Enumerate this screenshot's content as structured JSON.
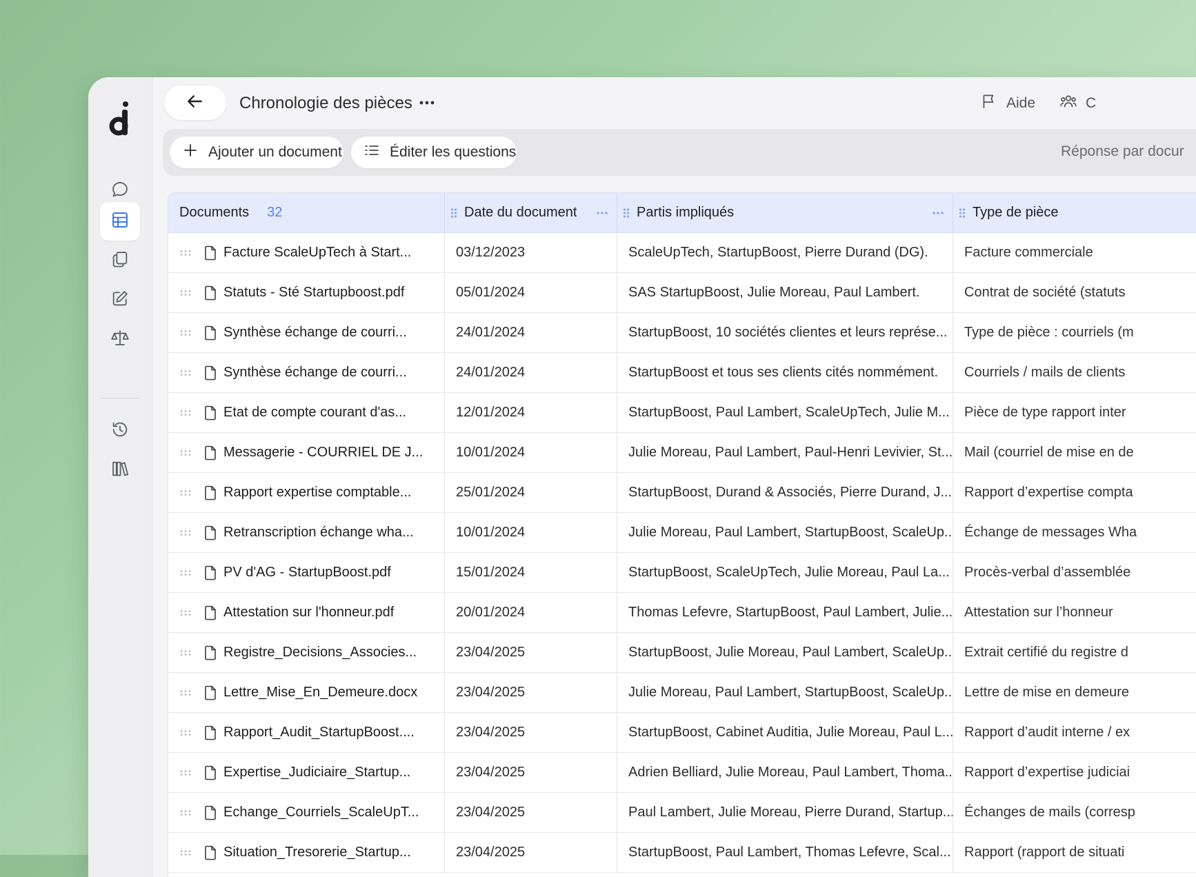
{
  "header": {
    "title": "Chronologie des pièces",
    "help_label": "Aide",
    "partial_label": "C"
  },
  "toolbar": {
    "add_document_label": "Ajouter un document",
    "edit_questions_label": "Éditer les questions",
    "response_label": "Réponse par docur"
  },
  "table": {
    "documents_header": "Documents",
    "documents_count": "32",
    "date_header": "Date du document",
    "parties_header": "Partis impliqués",
    "type_header": "Type de pièce",
    "rows": [
      {
        "name": "Facture ScaleUpTech à Start...",
        "date": "03/12/2023",
        "parties": "ScaleUpTech, StartupBoost, Pierre Durand (DG).",
        "type": "Facture commerciale"
      },
      {
        "name": "Statuts - Sté Startupboost.pdf",
        "date": "05/01/2024",
        "parties": "SAS StartupBoost, Julie Moreau, Paul Lambert.",
        "type": "Contrat de société (statuts"
      },
      {
        "name": "Synthèse échange de courri...",
        "date": "24/01/2024",
        "parties": "StartupBoost, 10 sociétés clientes et leurs représe...",
        "type": "Type de pièce : courriels (m"
      },
      {
        "name": "Synthèse échange de courri...",
        "date": "24/01/2024",
        "parties": "StartupBoost et tous ses clients cités nommément.",
        "type": "Courriels / mails de clients"
      },
      {
        "name": "Etat de compte courant d'as...",
        "date": "12/01/2024",
        "parties": "StartupBoost, Paul Lambert, ScaleUpTech, Julie M...",
        "type": "Pièce de type rapport inter"
      },
      {
        "name": "Messagerie - COURRIEL DE J...",
        "date": "10/01/2024",
        "parties": "Julie Moreau, Paul Lambert, Paul-Henri Levivier, St...",
        "type": "Mail (courriel de mise en de"
      },
      {
        "name": "Rapport expertise comptable...",
        "date": "25/01/2024",
        "parties": "StartupBoost, Durand & Associés, Pierre Durand, J...",
        "type": "Rapport d’expertise compta"
      },
      {
        "name": "Retranscription échange wha...",
        "date": "10/01/2024",
        "parties": "Julie Moreau, Paul Lambert, StartupBoost, ScaleUp...",
        "type": "Échange de messages Wha"
      },
      {
        "name": "PV d'AG - StartupBoost.pdf",
        "date": "15/01/2024",
        "parties": "StartupBoost, ScaleUpTech, Julie Moreau, Paul La...",
        "type": "Procès-verbal d’assemblée"
      },
      {
        "name": "Attestation sur l'honneur.pdf",
        "date": "20/01/2024",
        "parties": "Thomas Lefevre, StartupBoost, Paul Lambert, Julie...",
        "type": "Attestation sur l’honneur"
      },
      {
        "name": "Registre_Decisions_Associes...",
        "date": "23/04/2025",
        "parties": "StartupBoost, Julie Moreau, Paul Lambert, ScaleUp...",
        "type": "Extrait certifié du registre d"
      },
      {
        "name": "Lettre_Mise_En_Demeure.docx",
        "date": "23/04/2025",
        "parties": "Julie Moreau, Paul Lambert, StartupBoost, ScaleUp...",
        "type": "Lettre de mise en demeure"
      },
      {
        "name": "Rapport_Audit_StartupBoost....",
        "date": "23/04/2025",
        "parties": "StartupBoost, Cabinet Auditia, Julie Moreau, Paul L...",
        "type": "Rapport d’audit interne / ex"
      },
      {
        "name": "Expertise_Judiciaire_Startup...",
        "date": "23/04/2025",
        "parties": "Adrien Belliard, Julie Moreau, Paul Lambert, Thoma...",
        "type": "Rapport d’expertise judiciai"
      },
      {
        "name": "Echange_Courriels_ScaleUpT...",
        "date": "23/04/2025",
        "parties": "Paul Lambert, Julie Moreau, Pierre Durand, Startup...",
        "type": "Échanges de mails (corresp"
      },
      {
        "name": "Situation_Tresorerie_Startup...",
        "date": "23/04/2025",
        "parties": "StartupBoost, Paul Lambert, Thomas Lefevre, Scal...",
        "type": "Rapport (rapport de situati"
      }
    ]
  },
  "colors": {
    "accent": "#2f6fe8",
    "header_row": "#e3ebfd",
    "background_green": "#a5d1a9"
  },
  "icons": {
    "sidebar": [
      "chat-icon",
      "table-icon",
      "documents-icon",
      "edit-icon",
      "balance-scale-icon",
      "history-icon",
      "library-icon"
    ],
    "header": [
      "arrow-left-icon",
      "more-horizontal-icon",
      "flag-icon",
      "users-icon"
    ]
  }
}
